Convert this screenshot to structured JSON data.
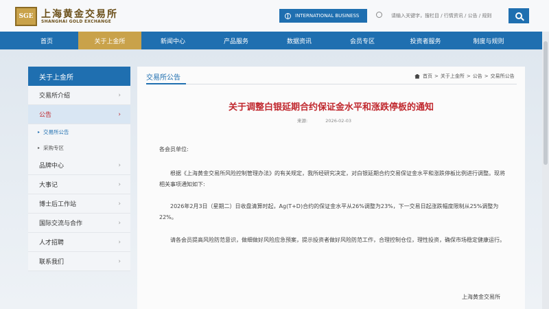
{
  "header": {
    "logo_mark": "SGE",
    "logo_cn": "上海黄金交易所",
    "logo_en": "SHANGHAI GOLD EXCHANGE",
    "intl_label": "INTERNATIONAL BUSINESS",
    "search_placeholder": "请输入关键字，搜栏目 / 行情资讯 / 公告 / 规则"
  },
  "nav": [
    "首页",
    "关于上金所",
    "新闻中心",
    "产品服务",
    "数据资讯",
    "会员专区",
    "投资者服务",
    "制度与规则"
  ],
  "sidebar": {
    "title": "关于上金所",
    "items": [
      {
        "label": "交易所介绍"
      },
      {
        "label": "公告"
      },
      {
        "label": "品牌中心"
      },
      {
        "label": "大事记"
      },
      {
        "label": "博士后工作站"
      },
      {
        "label": "国际交流与合作"
      },
      {
        "label": "人才招聘"
      },
      {
        "label": "联系我们"
      }
    ],
    "subitems": [
      {
        "label": "交易所公告"
      },
      {
        "label": "采购专区"
      }
    ]
  },
  "main": {
    "section_title": "交易所公告",
    "breadcrumb": [
      "首页",
      "关于上金所",
      "公告",
      "交易所公告"
    ],
    "article_title": "关于调整白银延期合约保证金水平和涨跌停板的通知",
    "source_label": "来源:",
    "date": "2026-02-03",
    "paragraphs": [
      "各会员单位:",
      "根据《上海黄金交易所风险控制管理办法》的有关规定，我所经研究决定，对白银延期合约交易保证金水平和涨跌停板比例进行调整。现将相关事项通知如下:",
      "2026年2月3日（星期二）日收盘清算时起，Ag(T+D)合约的保证金水平从26%调整为23%，下一交易日起涨跌幅度限制从25%调整为22%。",
      "请各会员提高风险防范意识，做细做好风险应急预案，提示投资者做好风险防范工作，合理控制仓位，理性投资，确保市场稳定健康运行。"
    ],
    "signature": "上海黄金交易所"
  },
  "colors": {
    "brand_blue": "#1f6fb0",
    "gold": "#c9a24a",
    "title_red": "#c0272d"
  }
}
